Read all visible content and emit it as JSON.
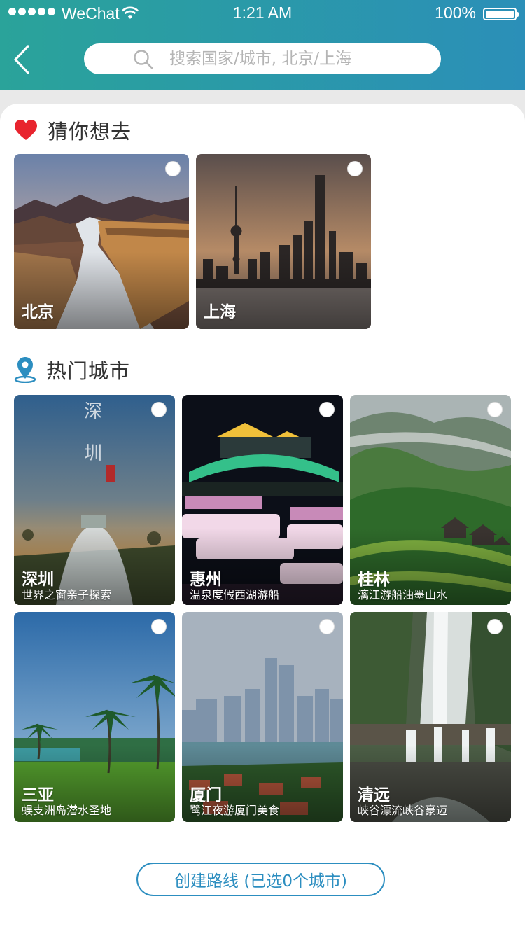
{
  "status_bar": {
    "carrier": "WeChat",
    "time": "1:21 AM",
    "battery": "100%"
  },
  "search": {
    "placeholder": "搜索国家/城市, 北京/上海"
  },
  "guess": {
    "title": "猜你想去",
    "cities": [
      {
        "name": "北京"
      },
      {
        "name": "上海"
      }
    ]
  },
  "hot": {
    "title": "热门城市",
    "cities": [
      {
        "name": "深圳",
        "desc": "世界之窗亲子探索"
      },
      {
        "name": "惠州",
        "desc": "温泉度假西湖游船"
      },
      {
        "name": "桂林",
        "desc": "漓江游船油墨山水"
      },
      {
        "name": "三亚",
        "desc": "蜈支洲岛潜水圣地"
      },
      {
        "name": "厦门",
        "desc": "鹭江夜游厦门美食"
      },
      {
        "name": "清远",
        "desc": "峡谷漂流峡谷豪迈"
      }
    ]
  },
  "footer": {
    "create_route_label": "创建路线 (已选0个城市)"
  },
  "colors": {
    "header_start": "#2aa39a",
    "header_end": "#2b8fb8",
    "accent": "#2c8ec0",
    "heart": "#e8242e"
  }
}
